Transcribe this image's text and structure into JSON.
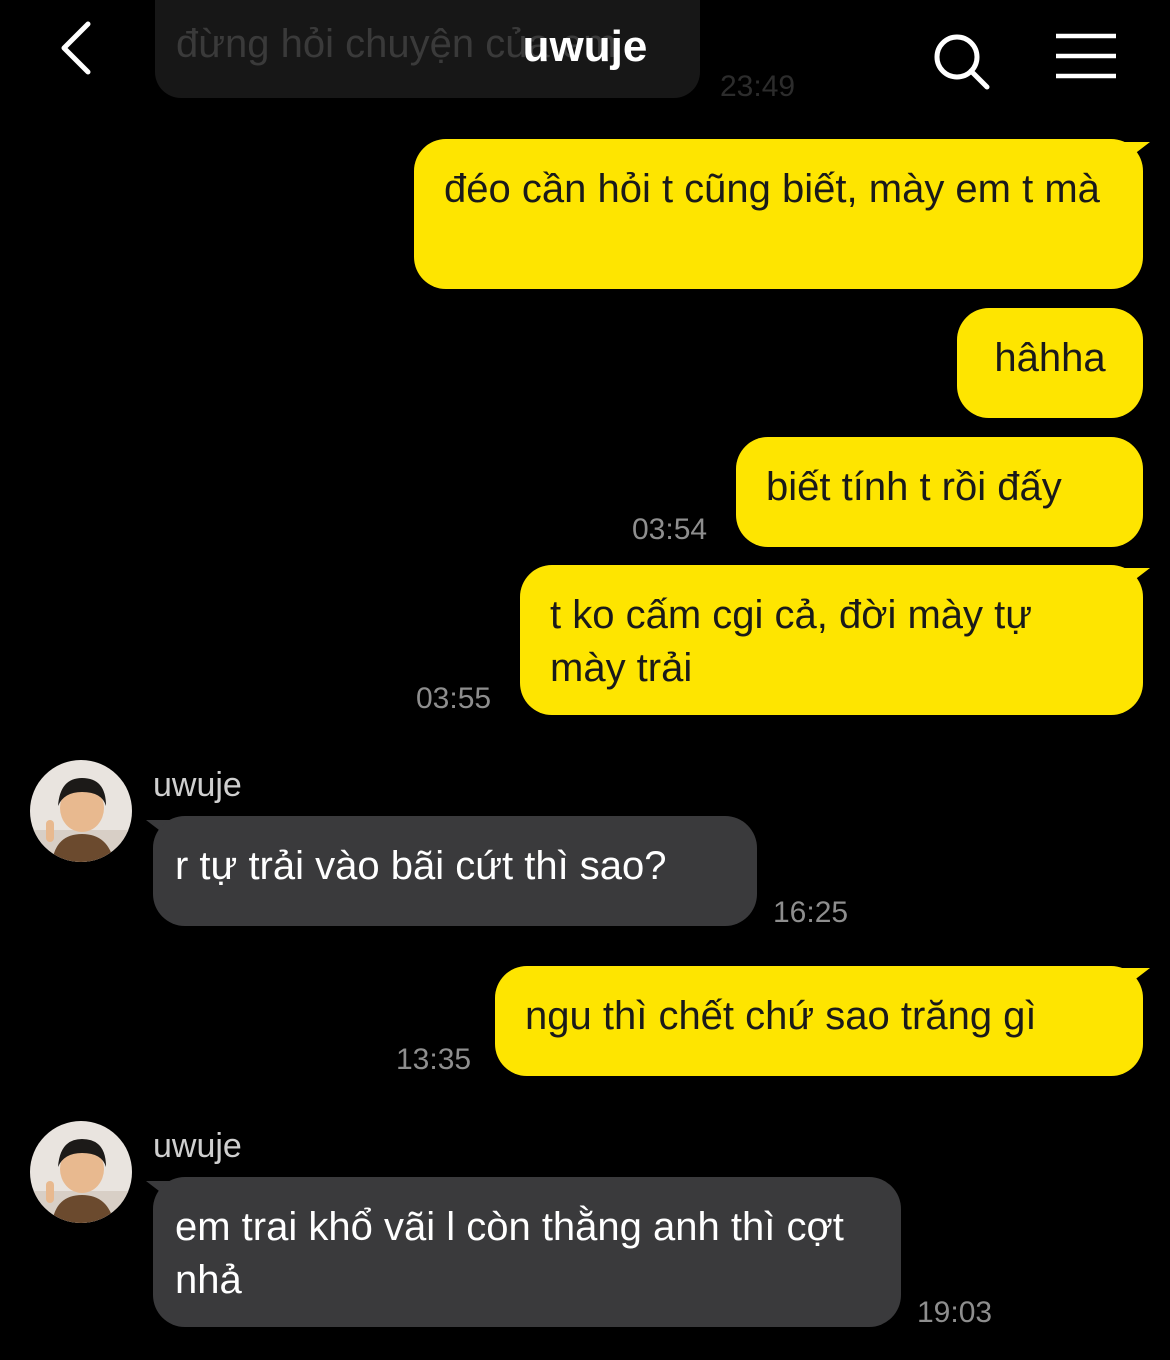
{
  "header": {
    "title": "uwuje",
    "back_icon": "chevron-left-icon",
    "search_icon": "search-icon",
    "menu_icon": "hamburger-menu-icon"
  },
  "previous_message": {
    "text": "đừng hỏi chuyện của em",
    "time": "23:49"
  },
  "colors": {
    "background": "#000000",
    "sent_bubble": "#fee500",
    "received_bubble": "#3a3a3c",
    "timestamp": "#8e8e8e"
  },
  "messages": [
    {
      "direction": "sent",
      "text": "đéo cần hỏi t cũng biết, mày em t mà",
      "time": ""
    },
    {
      "direction": "sent",
      "text": "hâhha",
      "time": ""
    },
    {
      "direction": "sent",
      "text": "biết tính t rồi đấy",
      "time": "03:54"
    },
    {
      "direction": "sent",
      "text": "t ko cấm cgi cả, đời mày tự mày trải",
      "time": "03:55"
    },
    {
      "direction": "received",
      "sender": "uwuje",
      "text": "r tự trải vào bãi cứt thì sao?",
      "time": "16:25"
    },
    {
      "direction": "sent",
      "text": "ngu thì chết chứ sao trăng gì",
      "time": "13:35"
    },
    {
      "direction": "received",
      "sender": "uwuje",
      "text": "em trai khổ vãi l còn thằng anh thì cợt nhả",
      "time": "19:03"
    }
  ]
}
